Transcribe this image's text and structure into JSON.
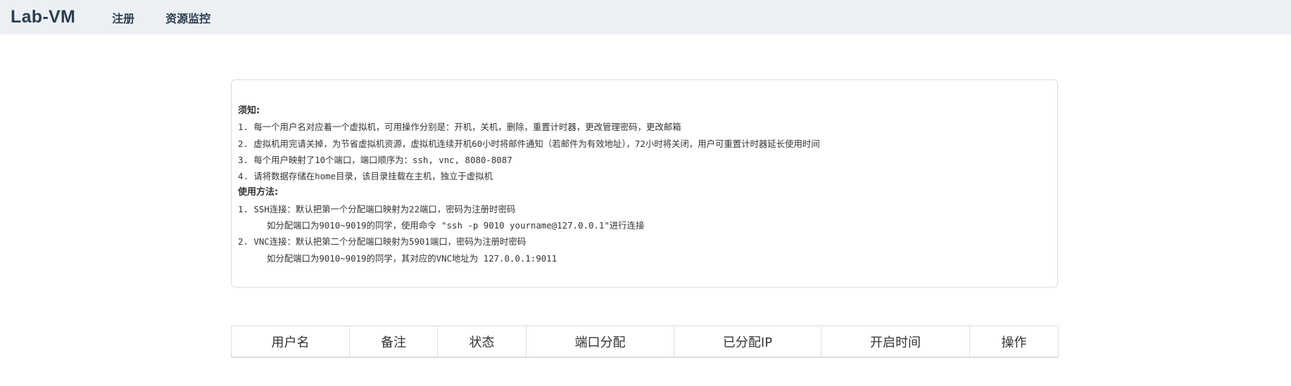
{
  "navbar": {
    "brand": "Lab-VM",
    "links": [
      "注册",
      "资源监控"
    ]
  },
  "notice": {
    "lines": [
      "须知:",
      "1. 每一个用户名对应着一个虚拟机，可用操作分别是：开机，关机，删除，重置计时器，更改管理密码，更改邮箱",
      "2. 虚拟机用完请关掉，为节省虚拟机资源，虚拟机连续开机60小时将邮件通知（若邮件为有效地址），72小时将关闭，用户可重置计时器延长使用时间",
      "3. 每个用户映射了10个端口，端口顺序为：ssh, vnc, 8080-8087",
      "4. 请将数据存储在home目录，该目录挂载在主机，独立于虚拟机",
      "使用方法:",
      "1. SSH连接：默认把第一个分配端口映射为22端口，密码为注册时密码",
      "如分配端口为9010~9019的同学，使用命令 \"ssh -p 9010 yourname@127.0.0.1\"进行连接",
      "2. VNC连接：默认把第二个分配端口映射为5901端口，密码为注册时密码",
      "如分配端口为9010~9019的同学，其对应的VNC地址为 127.0.0.1:9011"
    ]
  },
  "table": {
    "headers": [
      "用户名",
      "备注",
      "状态",
      "端口分配",
      "已分配IP",
      "开启时间",
      "操作"
    ]
  }
}
